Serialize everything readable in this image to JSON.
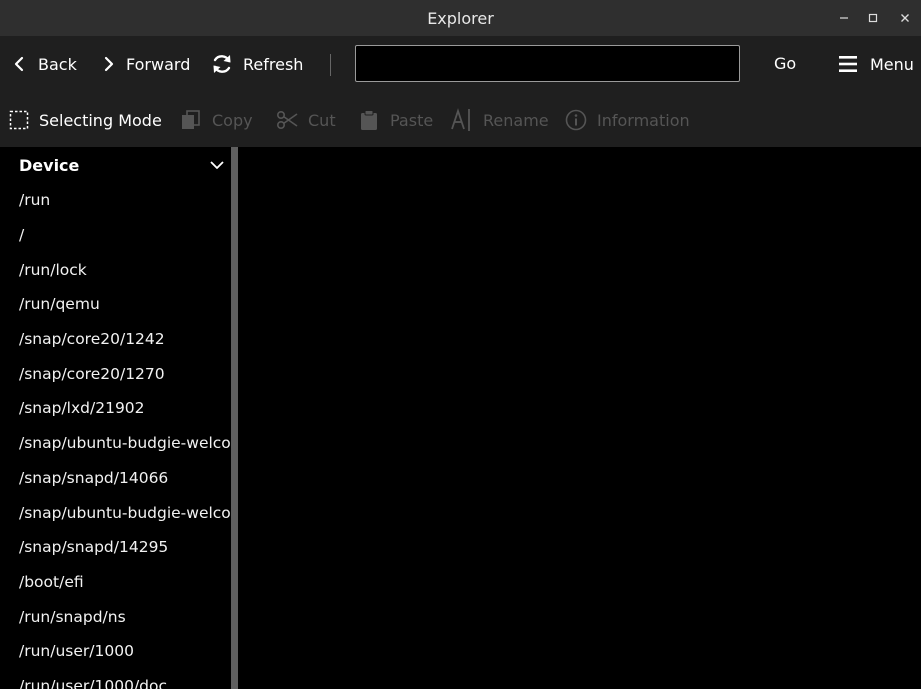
{
  "window": {
    "title": "Explorer"
  },
  "toolbar": {
    "back_label": "Back",
    "forward_label": "Forward",
    "refresh_label": "Refresh",
    "address_value": "",
    "go_label": "Go",
    "menu_label": "Menu"
  },
  "actions": {
    "selecting_mode": "Selecting Mode",
    "copy": "Copy",
    "cut": "Cut",
    "paste": "Paste",
    "rename": "Rename",
    "information": "Information"
  },
  "sidebar": {
    "header": "Device",
    "items": [
      "/run",
      "/",
      "/run/lock",
      "/run/qemu",
      "/snap/core20/1242",
      "/snap/core20/1270",
      "/snap/lxd/21902",
      "/snap/ubuntu-budgie-welco",
      "/snap/snapd/14066",
      "/snap/ubuntu-budgie-welco",
      "/snap/snapd/14295",
      "/boot/efi",
      "/run/snapd/ns",
      "/run/user/1000",
      "/run/user/1000/doc"
    ]
  },
  "colors": {
    "titlebar": "#2f2f2f",
    "toolbar": "#1f1f1f",
    "content": "#000000",
    "disabled_text": "#555555",
    "splitter": "#5f5f5f"
  }
}
